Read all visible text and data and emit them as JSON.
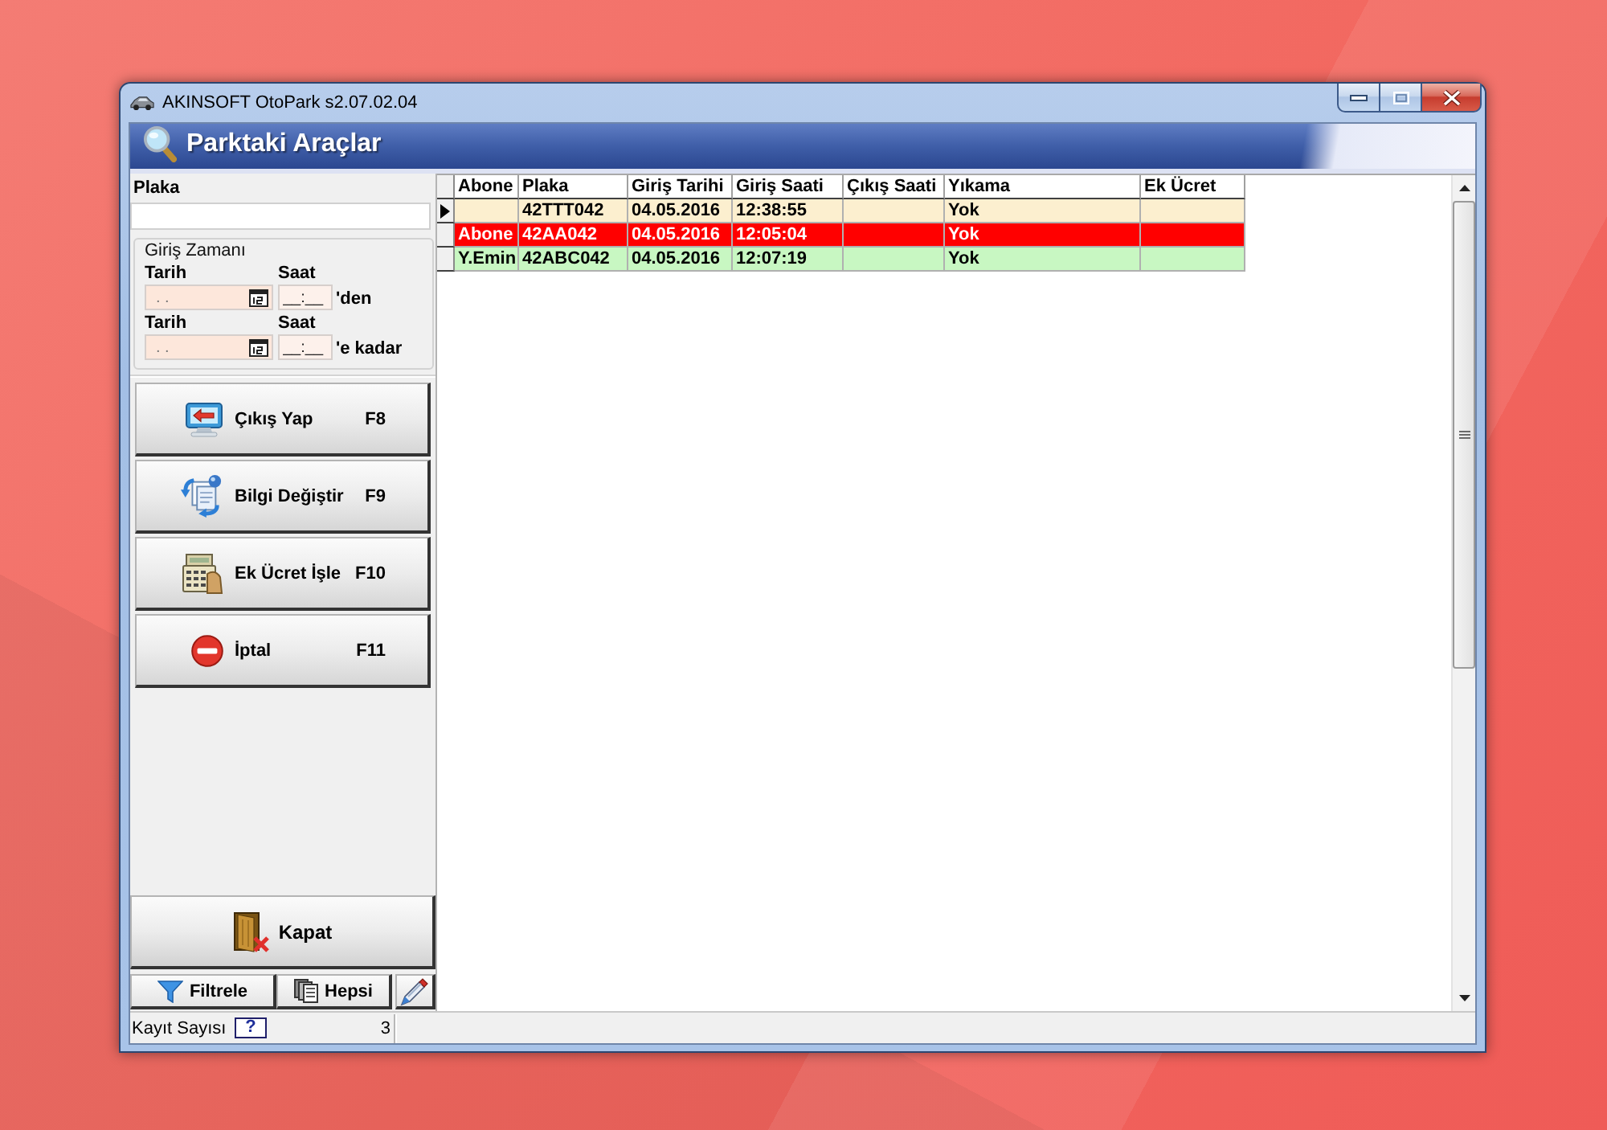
{
  "window": {
    "title": "AKINSOFT OtoPark s2.07.02.04"
  },
  "header": {
    "title": "Parktaki Araçlar"
  },
  "filter": {
    "plate_label": "Plaka",
    "entry_time": {
      "title": "Giriş Zamanı",
      "rows": [
        {
          "date": {
            "label": "Tarih",
            "placeholder": ". ."
          },
          "time": {
            "label": "Saat",
            "placeholder": "__:__"
          },
          "suffix": "'den"
        },
        {
          "date": {
            "label": "Tarih",
            "placeholder": ". ."
          },
          "time": {
            "label": "Saat",
            "placeholder": "__:__"
          },
          "suffix": "'e kadar"
        }
      ]
    }
  },
  "actions": [
    {
      "kind": "exit",
      "label": "Çıkış Yap",
      "shortcut": "F8"
    },
    {
      "kind": "edit",
      "label": "Bilgi Değiştir",
      "shortcut": "F9"
    },
    {
      "kind": "fee",
      "label": "Ek Ücret İşle",
      "shortcut": "F10"
    },
    {
      "kind": "cancel",
      "label": "İptal",
      "shortcut": "F11"
    }
  ],
  "close_button": {
    "label": "Kapat"
  },
  "bottom_buttons": [
    {
      "kind": "filter",
      "label": "Filtrele"
    },
    {
      "kind": "all",
      "label": "Hepsi"
    },
    {
      "kind": "clear"
    }
  ],
  "table": {
    "columns": [
      "Abone",
      "Plaka",
      "Giriş Tarihi",
      "Giriş Saati",
      "Çıkış Saati",
      "Yıkama",
      "Ek Ücret"
    ],
    "rows": [
      {
        "selected": true,
        "color": "#fcefcf",
        "cells": [
          null,
          "42TTT042",
          "04.05.2016",
          "12:38:55",
          null,
          "Yok",
          null
        ]
      },
      {
        "selected": false,
        "color": "#ff0000",
        "cells": [
          "Abone",
          "42AA042",
          "04.05.2016",
          "12:05:04",
          null,
          "Yok",
          null
        ]
      },
      {
        "selected": false,
        "color": "#c8f7c2",
        "cells": [
          "Y.Emin",
          "42ABC042",
          "04.05.2016",
          "12:07:19",
          null,
          "Yok",
          null
        ]
      }
    ]
  },
  "status_bar": {
    "label": "Kayıt Sayısı",
    "help": "?",
    "count": "3"
  }
}
